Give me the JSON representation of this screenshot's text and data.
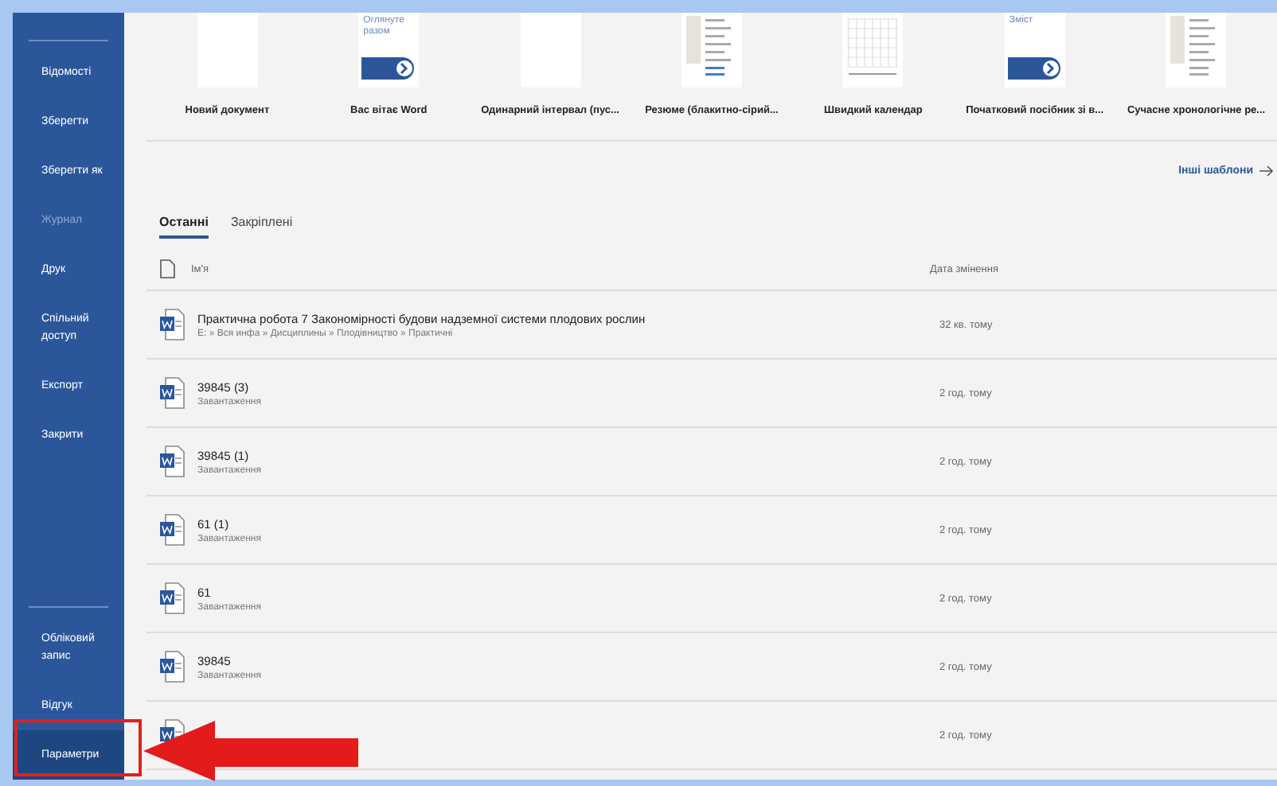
{
  "sidebar": {
    "items": [
      {
        "label": "Відомості",
        "disabled": false,
        "selected": false
      },
      {
        "label": "Зберегти",
        "disabled": false,
        "selected": false
      },
      {
        "label": "Зберегти як",
        "disabled": false,
        "selected": false
      },
      {
        "label": "Журнал",
        "disabled": true,
        "selected": false
      },
      {
        "label": "Друк",
        "disabled": false,
        "selected": false
      },
      {
        "label": "Спільний доступ",
        "disabled": false,
        "selected": false
      },
      {
        "label": "Експорт",
        "disabled": false,
        "selected": false
      },
      {
        "label": "Закрити",
        "disabled": false,
        "selected": false
      }
    ],
    "bottom_items": [
      {
        "label": "Обліковий запис",
        "disabled": false,
        "selected": false
      },
      {
        "label": "Відгук",
        "disabled": false,
        "selected": false
      },
      {
        "label": "Параметри",
        "disabled": false,
        "selected": true
      }
    ]
  },
  "templates": [
    {
      "kind": "blank",
      "label": "Новий документ"
    },
    {
      "kind": "welcome",
      "label": "Вас вітає Word",
      "thumb_text": "Оглянуте разом"
    },
    {
      "kind": "blank",
      "label": "Одинарний інтервал (пус..."
    },
    {
      "kind": "resume",
      "label": "Резюме (блакитно-сірий..."
    },
    {
      "kind": "calendar",
      "label": "Швидкий календар"
    },
    {
      "kind": "welcome",
      "label": "Початковий посібник зі в...",
      "thumb_text": "Зміст"
    },
    {
      "kind": "resume",
      "label": "Сучасне хронологічне ре..."
    }
  ],
  "more_templates": "Інші шаблони",
  "tabs": [
    {
      "label": "Останні",
      "selected": true
    },
    {
      "label": "Закріплені",
      "selected": false
    }
  ],
  "table": {
    "columns": [
      "Ім'я",
      "Дата змінення"
    ],
    "rows": [
      {
        "name": "Практична робота 7 Закономірності будови надземної системи плодових рослин",
        "location": "E: » Вся инфа » Дисциплины » Плодівництво » Практичні",
        "modified": "32 кв. тому"
      },
      {
        "name": "39845 (3)",
        "location": "Завантаження",
        "modified": "2 год. тому"
      },
      {
        "name": "39845 (1)",
        "location": "Завантаження",
        "modified": "2 год. тому"
      },
      {
        "name": "61 (1)",
        "location": "Завантаження",
        "modified": "2 год. тому"
      },
      {
        "name": "61",
        "location": "Завантаження",
        "modified": "2 год. тому"
      },
      {
        "name": "39845",
        "location": "Завантаження",
        "modified": "2 год. тому"
      },
      {
        "modified": "2 год. тому"
      }
    ]
  }
}
